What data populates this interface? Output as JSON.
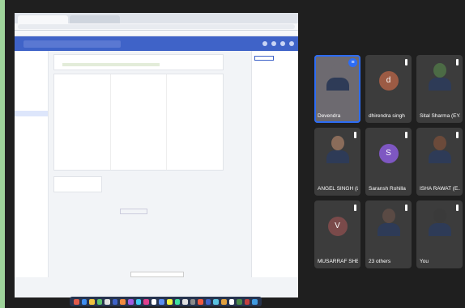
{
  "share": {
    "browser_tabs": [
      "",
      ""
    ],
    "brand": "",
    "search_placeholder": "",
    "sidebar_items": [
      "",
      "",
      "",
      "",
      "",
      "",
      "",
      "",
      "",
      "",
      "",
      "",
      "",
      "",
      "",
      "",
      "",
      "",
      "",
      "",
      "",
      ""
    ],
    "card_title": "",
    "columns": [
      {
        "heading": "",
        "links": [
          "",
          "",
          "",
          ""
        ]
      },
      {
        "heading": "",
        "links": [
          "",
          "",
          ""
        ]
      },
      {
        "heading": "",
        "links": [
          "",
          "",
          "",
          ""
        ]
      }
    ],
    "panel_title": "",
    "panel_items": [
      "",
      "",
      "",
      "",
      "",
      "",
      ""
    ],
    "toast": ""
  },
  "participants": [
    {
      "name": "Devendra",
      "avatar_letter": "",
      "avatar_color": "#6d6a70",
      "speaking": true
    },
    {
      "name": "dhirendra singh",
      "avatar_letter": "d",
      "avatar_color": "#9c5b44",
      "speaking": false
    },
    {
      "name": "Sital Sharma (EY...",
      "avatar_letter": "",
      "avatar_color": "#4c6b45",
      "speaking": false
    },
    {
      "name": "ANGEL SINGH (L...",
      "avatar_letter": "",
      "avatar_color": "#8a6c5a",
      "speaking": false
    },
    {
      "name": "Saransh Rohilla",
      "avatar_letter": "S",
      "avatar_color": "#7e57c2",
      "speaking": false
    },
    {
      "name": "ISHA RAWAT (E...",
      "avatar_letter": "",
      "avatar_color": "#6b4a3a",
      "speaking": false
    },
    {
      "name": "MUSARRAF SHE...",
      "avatar_letter": "V",
      "avatar_color": "#7a4a4a",
      "speaking": false
    },
    {
      "name": "23 others",
      "avatar_letter": "",
      "avatar_color": "#5a4a44",
      "speaking": false
    },
    {
      "name": "You",
      "avatar_letter": "",
      "avatar_color": "#3a3a3a",
      "speaking": false
    }
  ],
  "colors": {
    "background": "#9fd49b",
    "meeting_bg": "#1f1f1f",
    "app_bar": "#3f63c8",
    "active_speaker": "#2c6cf5"
  }
}
